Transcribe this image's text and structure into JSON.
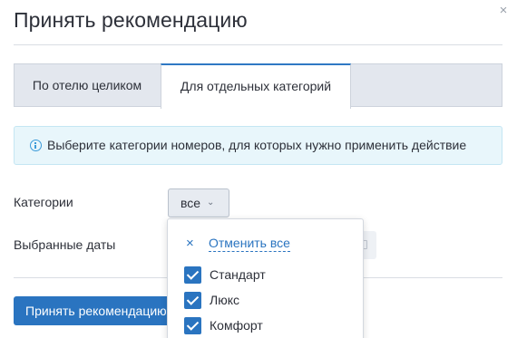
{
  "dialog": {
    "title": "Принять рекомендацию",
    "close_glyph": "×"
  },
  "tabs": [
    {
      "label": "По отелю целиком",
      "active": false
    },
    {
      "label": "Для отдельных категорий",
      "active": true
    }
  ],
  "info": {
    "icon": "info-icon",
    "text": "Выберите категории номеров, для которых нужно применить действие"
  },
  "form": {
    "categories_label": "Категории",
    "categories_value": "все",
    "dates_label": "Выбранные даты"
  },
  "dropdown": {
    "clear_label": "Отменить все",
    "items": [
      {
        "label": "Стандарт",
        "checked": true
      },
      {
        "label": "Люкс",
        "checked": true
      },
      {
        "label": "Комфорт",
        "checked": true
      }
    ]
  },
  "footer": {
    "primary_label": "Принять рекомендацию"
  },
  "colors": {
    "accent": "#2a74c0",
    "info_bg": "#e8f6fb",
    "tab_bg": "#e3e7ee"
  }
}
